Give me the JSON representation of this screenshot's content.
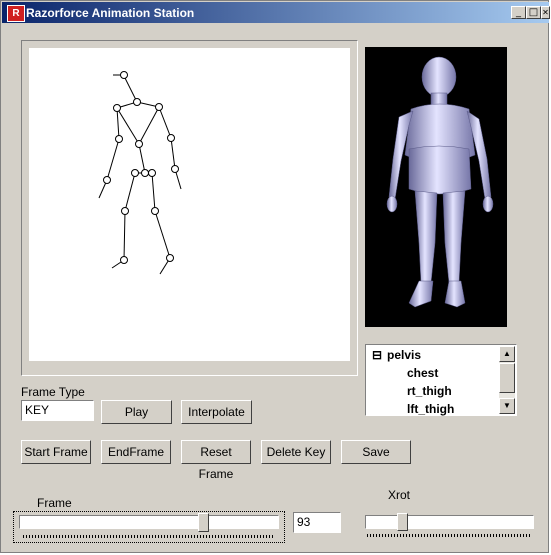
{
  "window": {
    "title": "Razorforce Animation Station",
    "icon": "app-logo-icon",
    "controls": {
      "minimize": "_",
      "maximize": "□",
      "close": "✕"
    }
  },
  "skeleton_view": {
    "background": "#ffffff"
  },
  "model_preview": {
    "background": "#000000",
    "model_color": "#b8b8e8"
  },
  "bone_tree": {
    "items": [
      {
        "label": "pelvis",
        "expander": "⊟"
      },
      {
        "label": "chest"
      },
      {
        "label": "rt_thigh"
      },
      {
        "label": "lft_thigh"
      }
    ],
    "scroll_up": "▲",
    "scroll_down": "▼"
  },
  "frame_type": {
    "label": "Frame Type",
    "value": "KEY"
  },
  "buttons": {
    "play": "Play",
    "interpolate": "Interpolate",
    "start_frame": "Start Frame",
    "end_frame": "EndFrame",
    "reset_frame": "Reset Frame",
    "delete_key": "Delete Key",
    "save": "Save"
  },
  "frame_slider": {
    "label": "Frame",
    "value": "93",
    "position": 0.72
  },
  "xrot_slider": {
    "label": "Xrot",
    "position": 0.2
  }
}
